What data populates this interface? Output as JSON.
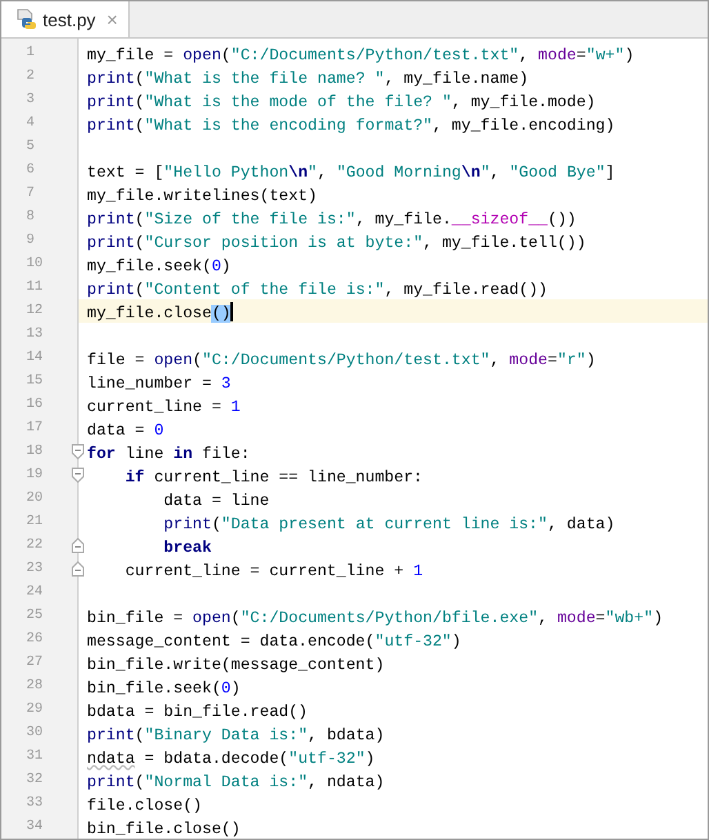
{
  "tabs": [
    {
      "label": "test.py",
      "selected": true,
      "close": "×"
    }
  ],
  "lines": [
    {
      "number": "1",
      "tokens": [
        {
          "text": "my_file = ",
          "kind": "plain"
        },
        {
          "text": "open",
          "kind": "builtin"
        },
        {
          "text": "(",
          "kind": "plain"
        },
        {
          "text": "\"C:/Documents/Python/test.txt\"",
          "kind": "string"
        },
        {
          "text": ", ",
          "kind": "plain"
        },
        {
          "text": "mode",
          "kind": "kwarg"
        },
        {
          "text": "=",
          "kind": "plain"
        },
        {
          "text": "\"w+\"",
          "kind": "string"
        },
        {
          "text": ")",
          "kind": "plain"
        }
      ]
    },
    {
      "number": "2",
      "tokens": [
        {
          "text": "print",
          "kind": "builtin"
        },
        {
          "text": "(",
          "kind": "plain"
        },
        {
          "text": "\"What is the file name? \"",
          "kind": "string"
        },
        {
          "text": ", my_file.name)",
          "kind": "plain"
        }
      ]
    },
    {
      "number": "3",
      "tokens": [
        {
          "text": "print",
          "kind": "builtin"
        },
        {
          "text": "(",
          "kind": "plain"
        },
        {
          "text": "\"What is the mode of the file? \"",
          "kind": "string"
        },
        {
          "text": ", my_file.mode)",
          "kind": "plain"
        }
      ]
    },
    {
      "number": "4",
      "tokens": [
        {
          "text": "print",
          "kind": "builtin"
        },
        {
          "text": "(",
          "kind": "plain"
        },
        {
          "text": "\"What is the encoding format?\"",
          "kind": "string"
        },
        {
          "text": ", my_file.encoding)",
          "kind": "plain"
        }
      ]
    },
    {
      "number": "5"
    },
    {
      "number": "6",
      "tokens": [
        {
          "text": "text = [",
          "kind": "plain"
        },
        {
          "text": "\"Hello Python",
          "kind": "string"
        },
        {
          "text": "\\n",
          "kind": "escape"
        },
        {
          "text": "\"",
          "kind": "string"
        },
        {
          "text": ", ",
          "kind": "plain"
        },
        {
          "text": "\"Good Morning",
          "kind": "string"
        },
        {
          "text": "\\n",
          "kind": "escape"
        },
        {
          "text": "\"",
          "kind": "string"
        },
        {
          "text": ", ",
          "kind": "plain"
        },
        {
          "text": "\"Good Bye\"",
          "kind": "string"
        },
        {
          "text": "]",
          "kind": "plain"
        }
      ]
    },
    {
      "number": "7",
      "tokens": [
        {
          "text": "my_file.writelines(text)",
          "kind": "plain"
        }
      ]
    },
    {
      "number": "8",
      "tokens": [
        {
          "text": "print",
          "kind": "builtin"
        },
        {
          "text": "(",
          "kind": "plain"
        },
        {
          "text": "\"Size of the file is:\"",
          "kind": "string"
        },
        {
          "text": ", my_file.",
          "kind": "plain"
        },
        {
          "text": "__sizeof__",
          "kind": "dunder"
        },
        {
          "text": "())",
          "kind": "plain"
        }
      ]
    },
    {
      "number": "9",
      "tokens": [
        {
          "text": "print",
          "kind": "builtin"
        },
        {
          "text": "(",
          "kind": "plain"
        },
        {
          "text": "\"Cursor position is at byte:\"",
          "kind": "string"
        },
        {
          "text": ", my_file.tell())",
          "kind": "plain"
        }
      ]
    },
    {
      "number": "10",
      "tokens": [
        {
          "text": "my_file.seek(",
          "kind": "plain"
        },
        {
          "text": "0",
          "kind": "number"
        },
        {
          "text": ")",
          "kind": "plain"
        }
      ]
    },
    {
      "number": "11",
      "tokens": [
        {
          "text": "print",
          "kind": "builtin"
        },
        {
          "text": "(",
          "kind": "plain"
        },
        {
          "text": "\"Content of the file is:\"",
          "kind": "string"
        },
        {
          "text": ", my_file.read())",
          "kind": "plain"
        }
      ]
    },
    {
      "number": "12",
      "current": true,
      "tokens": [
        {
          "text": "my_file.close",
          "kind": "plain"
        },
        {
          "text": "()",
          "kind": "match"
        }
      ]
    },
    {
      "number": "13"
    },
    {
      "number": "14",
      "tokens": [
        {
          "text": "file = ",
          "kind": "plain"
        },
        {
          "text": "open",
          "kind": "builtin"
        },
        {
          "text": "(",
          "kind": "plain"
        },
        {
          "text": "\"C:/Documents/Python/test.txt\"",
          "kind": "string"
        },
        {
          "text": ", ",
          "kind": "plain"
        },
        {
          "text": "mode",
          "kind": "kwarg"
        },
        {
          "text": "=",
          "kind": "plain"
        },
        {
          "text": "\"r\"",
          "kind": "string"
        },
        {
          "text": ")",
          "kind": "plain"
        }
      ]
    },
    {
      "number": "15",
      "tokens": [
        {
          "text": "line_number = ",
          "kind": "plain"
        },
        {
          "text": "3",
          "kind": "number"
        }
      ]
    },
    {
      "number": "16",
      "tokens": [
        {
          "text": "current_line = ",
          "kind": "plain"
        },
        {
          "text": "1",
          "kind": "number"
        }
      ]
    },
    {
      "number": "17",
      "tokens": [
        {
          "text": "data = ",
          "kind": "plain"
        },
        {
          "text": "0",
          "kind": "number"
        }
      ]
    },
    {
      "number": "18",
      "fold_start": true,
      "tokens": [
        {
          "text": "for",
          "kind": "keyword"
        },
        {
          "text": " line ",
          "kind": "plain"
        },
        {
          "text": "in",
          "kind": "keyword"
        },
        {
          "text": " file:",
          "kind": "plain"
        }
      ]
    },
    {
      "number": "19",
      "fold_start": true,
      "tokens": [
        {
          "text": "    if",
          "kind": "keyword"
        },
        {
          "text": " current_line == line_number:",
          "kind": "plain"
        }
      ]
    },
    {
      "number": "20",
      "tokens": [
        {
          "text": "        data = line",
          "kind": "plain"
        }
      ]
    },
    {
      "number": "21",
      "tokens": [
        {
          "text": "        print",
          "kind": "builtin"
        },
        {
          "text": "(",
          "kind": "plain"
        },
        {
          "text": "\"Data present at current line is:\"",
          "kind": "string"
        },
        {
          "text": ", data)",
          "kind": "plain"
        }
      ]
    },
    {
      "number": "22",
      "fold_end": true,
      "tokens": [
        {
          "text": "        break",
          "kind": "keyword"
        }
      ]
    },
    {
      "number": "23",
      "fold_end": true,
      "tokens": [
        {
          "text": "    current_line = current_line + ",
          "kind": "plain"
        },
        {
          "text": "1",
          "kind": "number"
        }
      ]
    },
    {
      "number": "24"
    },
    {
      "number": "25",
      "tokens": [
        {
          "text": "bin_file = ",
          "kind": "plain"
        },
        {
          "text": "open",
          "kind": "builtin"
        },
        {
          "text": "(",
          "kind": "plain"
        },
        {
          "text": "\"C:/Documents/Python/bfile.exe\"",
          "kind": "string"
        },
        {
          "text": ", ",
          "kind": "plain"
        },
        {
          "text": "mode",
          "kind": "kwarg"
        },
        {
          "text": "=",
          "kind": "plain"
        },
        {
          "text": "\"wb+\"",
          "kind": "string"
        },
        {
          "text": ")",
          "kind": "plain"
        }
      ]
    },
    {
      "number": "26",
      "tokens": [
        {
          "text": "message_content = data.encode(",
          "kind": "plain"
        },
        {
          "text": "\"utf-32\"",
          "kind": "string"
        },
        {
          "text": ")",
          "kind": "plain"
        }
      ]
    },
    {
      "number": "27",
      "tokens": [
        {
          "text": "bin_file.write(message_content)",
          "kind": "plain"
        }
      ]
    },
    {
      "number": "28",
      "tokens": [
        {
          "text": "bin_file.seek(",
          "kind": "plain"
        },
        {
          "text": "0",
          "kind": "number"
        },
        {
          "text": ")",
          "kind": "plain"
        }
      ]
    },
    {
      "number": "29",
      "tokens": [
        {
          "text": "bdata = bin_file.read()",
          "kind": "plain"
        }
      ]
    },
    {
      "number": "30",
      "tokens": [
        {
          "text": "print",
          "kind": "builtin"
        },
        {
          "text": "(",
          "kind": "plain"
        },
        {
          "text": "\"Binary Data is:\"",
          "kind": "string"
        },
        {
          "text": ", bdata)",
          "kind": "plain"
        }
      ]
    },
    {
      "number": "31",
      "tokens": [
        {
          "text": "ndata",
          "kind": "warning"
        },
        {
          "text": " = bdata.decode(",
          "kind": "plain"
        },
        {
          "text": "\"utf-32\"",
          "kind": "string"
        },
        {
          "text": ")",
          "kind": "plain"
        }
      ]
    },
    {
      "number": "32",
      "tokens": [
        {
          "text": "print",
          "kind": "builtin"
        },
        {
          "text": "(",
          "kind": "plain"
        },
        {
          "text": "\"Normal Data is:\"",
          "kind": "string"
        },
        {
          "text": ", ndata)",
          "kind": "plain"
        }
      ]
    },
    {
      "number": "33",
      "tokens": [
        {
          "text": "file.close()",
          "kind": "plain"
        }
      ]
    },
    {
      "number": "34",
      "tokens": [
        {
          "text": "bin_file.close()",
          "kind": "plain"
        }
      ]
    }
  ]
}
